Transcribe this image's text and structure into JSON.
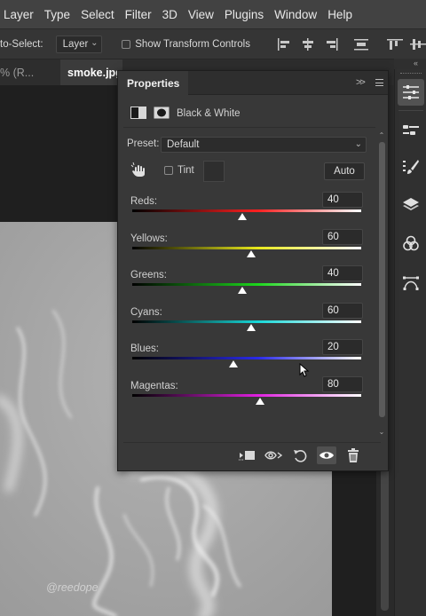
{
  "menu": {
    "items": [
      "Layer",
      "Type",
      "Select",
      "Filter",
      "3D",
      "View",
      "Plugins",
      "Window",
      "Help"
    ]
  },
  "options": {
    "auto_select_label": "to-Select:",
    "auto_select_value": "Layer",
    "show_transform_label": "Show Transform Controls"
  },
  "tabs": {
    "tab1": "% (R...",
    "tab2": "smoke.jpg"
  },
  "dock": {
    "tools": [
      "adjustments-icon",
      "properties-icon",
      "brush-settings-icon",
      "layers-icon",
      "channels-icon",
      "paths-icon"
    ]
  },
  "properties": {
    "title": "Properties",
    "adjustment_name": "Black & White",
    "preset_label": "Preset:",
    "preset_value": "Default",
    "tint_label": "Tint",
    "auto_label": "Auto",
    "sliders": [
      {
        "label": "Reds:",
        "value": "40",
        "colors": [
          "#000000",
          "#ff2020",
          "#ffffff"
        ]
      },
      {
        "label": "Yellows:",
        "value": "60",
        "colors": [
          "#000000",
          "#e8e81c",
          "#ffffff"
        ]
      },
      {
        "label": "Greens:",
        "value": "40",
        "colors": [
          "#000000",
          "#1cd61c",
          "#ffffff"
        ]
      },
      {
        "label": "Cyans:",
        "value": "60",
        "colors": [
          "#000000",
          "#18d8d8",
          "#ffffff"
        ]
      },
      {
        "label": "Blues:",
        "value": "20",
        "colors": [
          "#000000",
          "#2a2ae8",
          "#ffffff"
        ]
      },
      {
        "label": "Magentas:",
        "value": "80",
        "colors": [
          "#000000",
          "#e020e0",
          "#ffffff"
        ]
      }
    ],
    "slider_min": -200,
    "slider_max": 300
  },
  "canvas": {
    "watermark": "@reedope"
  },
  "colors": {
    "menubar": "#424242",
    "panel": "#383838",
    "image_gray": "#a8a8a8"
  }
}
